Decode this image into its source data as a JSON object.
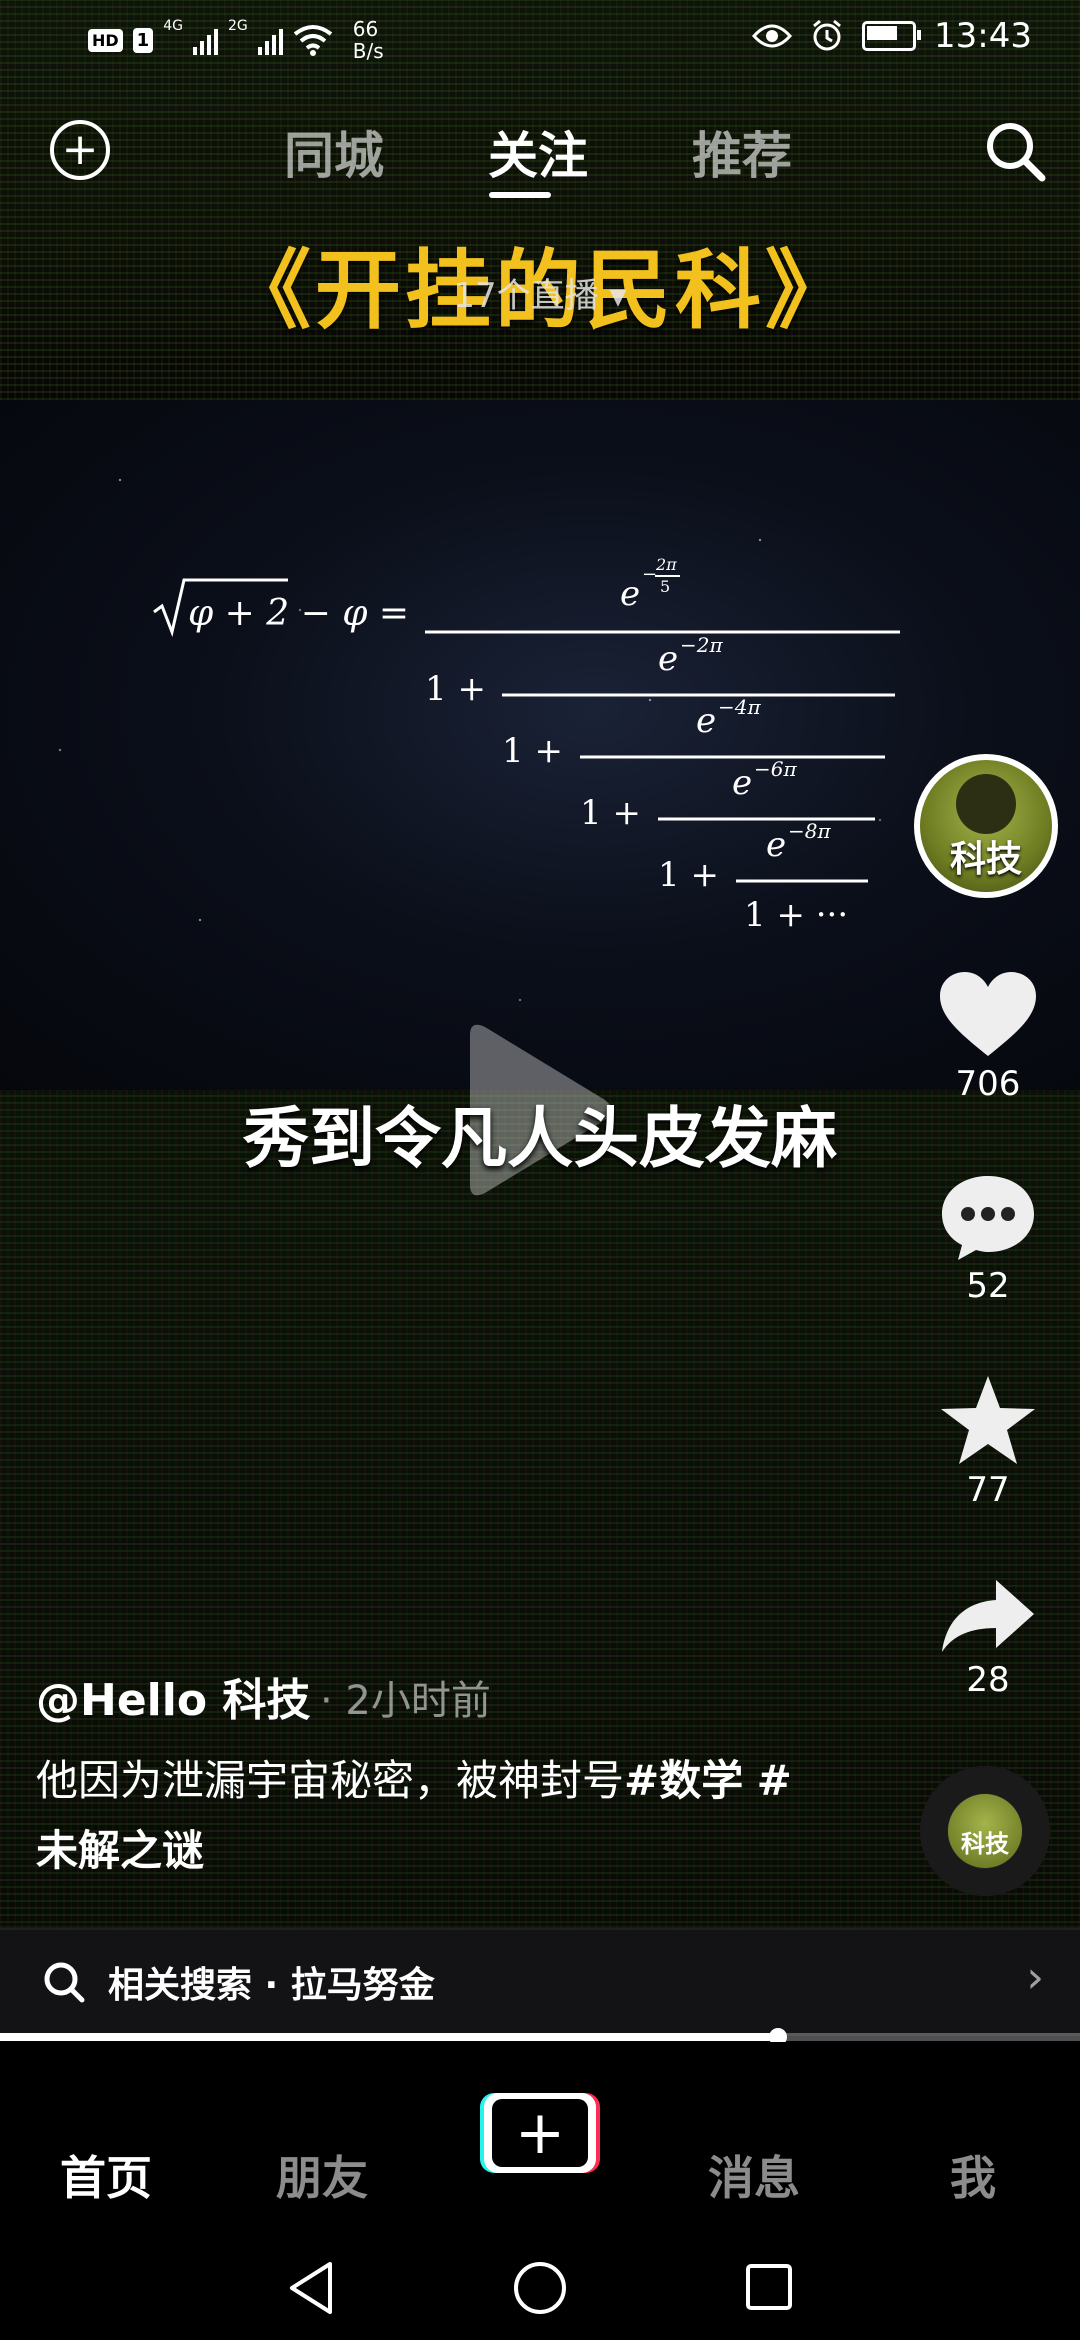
{
  "status_bar": {
    "hd": "HD",
    "sim_1": "1",
    "net_1": "4G",
    "net_2": "2G",
    "speed_value": "66",
    "speed_unit": "B/s",
    "time": "13:43"
  },
  "top_nav": {
    "tabs": [
      "同城",
      "关注",
      "推荐"
    ],
    "active_tab": "关注"
  },
  "video": {
    "title": "《开挂的民科》",
    "live_count": "17个直播 ▾",
    "caption": "秀到令凡人头皮发麻",
    "formula": {
      "lhs": "√φ+2 − φ =",
      "terms": [
        "e",
        "−2π/5",
        "1 +",
        "e",
        "−2π",
        "1 +",
        "e",
        "−4π",
        "1 +",
        "e",
        "−6π",
        "1 +",
        "e",
        "−8π",
        "1 + ···"
      ]
    }
  },
  "rail": {
    "avatar_text": "科技",
    "likes": "706",
    "comments": "52",
    "favorites": "77",
    "shares": "28",
    "disc_text": "科技"
  },
  "post": {
    "author": "@Hello 科技",
    "time": "· 2小时前",
    "description": "他因为泄漏宇宙秘密，被神封号",
    "hashtag_1": "#数学",
    "hashtag_2": "#未解之谜"
  },
  "related_search": {
    "label": "相关搜索 · 拉马努金"
  },
  "playback": {
    "progress": 0.72
  },
  "bottom_tabs": {
    "home": "首页",
    "friends": "朋友",
    "create": "+",
    "messages": "消息",
    "me": "我"
  }
}
